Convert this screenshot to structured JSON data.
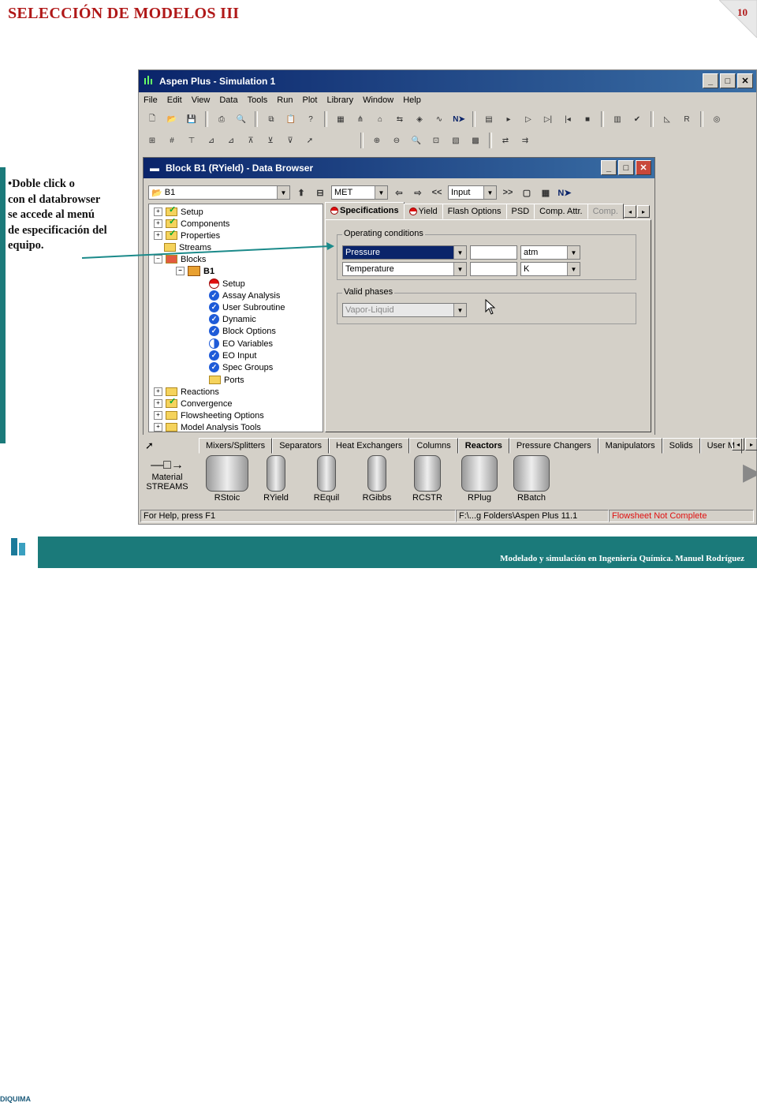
{
  "slide": {
    "title": "SELECCIÓN DE MODELOS III",
    "page_number": "10",
    "note_lines": [
      "•Doble click o",
      "con el databrowser",
      "se accede al menú",
      "de especificación del",
      "equipo."
    ],
    "footer": "Modelado y simulación en Ingeniería Química.  Manuel Rodríguez",
    "logo_text": "DIQUIMA"
  },
  "aspen": {
    "title": "Aspen Plus - Simulation 1",
    "menu": [
      "File",
      "Edit",
      "View",
      "Data",
      "Tools",
      "Run",
      "Plot",
      "Library",
      "Window",
      "Help"
    ]
  },
  "browser": {
    "title": "Block B1 (RYield) - Data Browser",
    "selector": "B1",
    "units": "MET",
    "nav_combo": "Input",
    "tree": [
      {
        "label": "Setup",
        "level": 0
      },
      {
        "label": "Components",
        "level": 0
      },
      {
        "label": "Properties",
        "level": 0
      },
      {
        "label": "Streams",
        "level": 0
      },
      {
        "label": "Blocks",
        "level": 0
      },
      {
        "label": "B1",
        "level": 1
      },
      {
        "label": "Setup",
        "level": 2
      },
      {
        "label": "Assay Analysis",
        "level": 2
      },
      {
        "label": "User Subroutine",
        "level": 2
      },
      {
        "label": "Dynamic",
        "level": 2
      },
      {
        "label": "Block Options",
        "level": 2
      },
      {
        "label": "EO Variables",
        "level": 2
      },
      {
        "label": "EO Input",
        "level": 2
      },
      {
        "label": "Spec Groups",
        "level": 2
      },
      {
        "label": "Ports",
        "level": 2
      },
      {
        "label": "Reactions",
        "level": 0
      },
      {
        "label": "Convergence",
        "level": 0
      },
      {
        "label": "Flowsheeting Options",
        "level": 0
      },
      {
        "label": "Model Analysis Tools",
        "level": 0
      }
    ],
    "tabs": [
      "Specifications",
      "Yield",
      "Flash Options",
      "PSD",
      "Comp. Attr.",
      "Comp."
    ],
    "operating_conditions_label": "Operating conditions",
    "pressure": {
      "var": "Pressure",
      "value": "",
      "unit": "atm"
    },
    "temperature": {
      "var": "Temperature",
      "value": "",
      "unit": "K"
    },
    "valid_phases_label": "Valid phases",
    "valid_phases_value": "Vapor-Liquid"
  },
  "library": {
    "tabs": [
      "Mixers/Splitters",
      "Separators",
      "Heat Exchangers",
      "Columns",
      "Reactors",
      "Pressure Changers",
      "Manipulators",
      "Solids",
      "User M"
    ],
    "active_tab": "Reactors",
    "stream_labels": [
      "Material",
      "STREAMS"
    ],
    "models": [
      "RStoic",
      "RYield",
      "REquil",
      "RGibbs",
      "RCSTR",
      "RPlug",
      "RBatch"
    ]
  },
  "status": {
    "help": "For Help, press F1",
    "path": "F:\\...g Folders\\Aspen Plus 11.1",
    "flowsheet": "Flowsheet Not Complete",
    "flowsheet_color": "#e01010"
  },
  "colors": {
    "title_red": "#b01818",
    "teal": "#1b7a7a",
    "titlebar": "#0a246a"
  }
}
